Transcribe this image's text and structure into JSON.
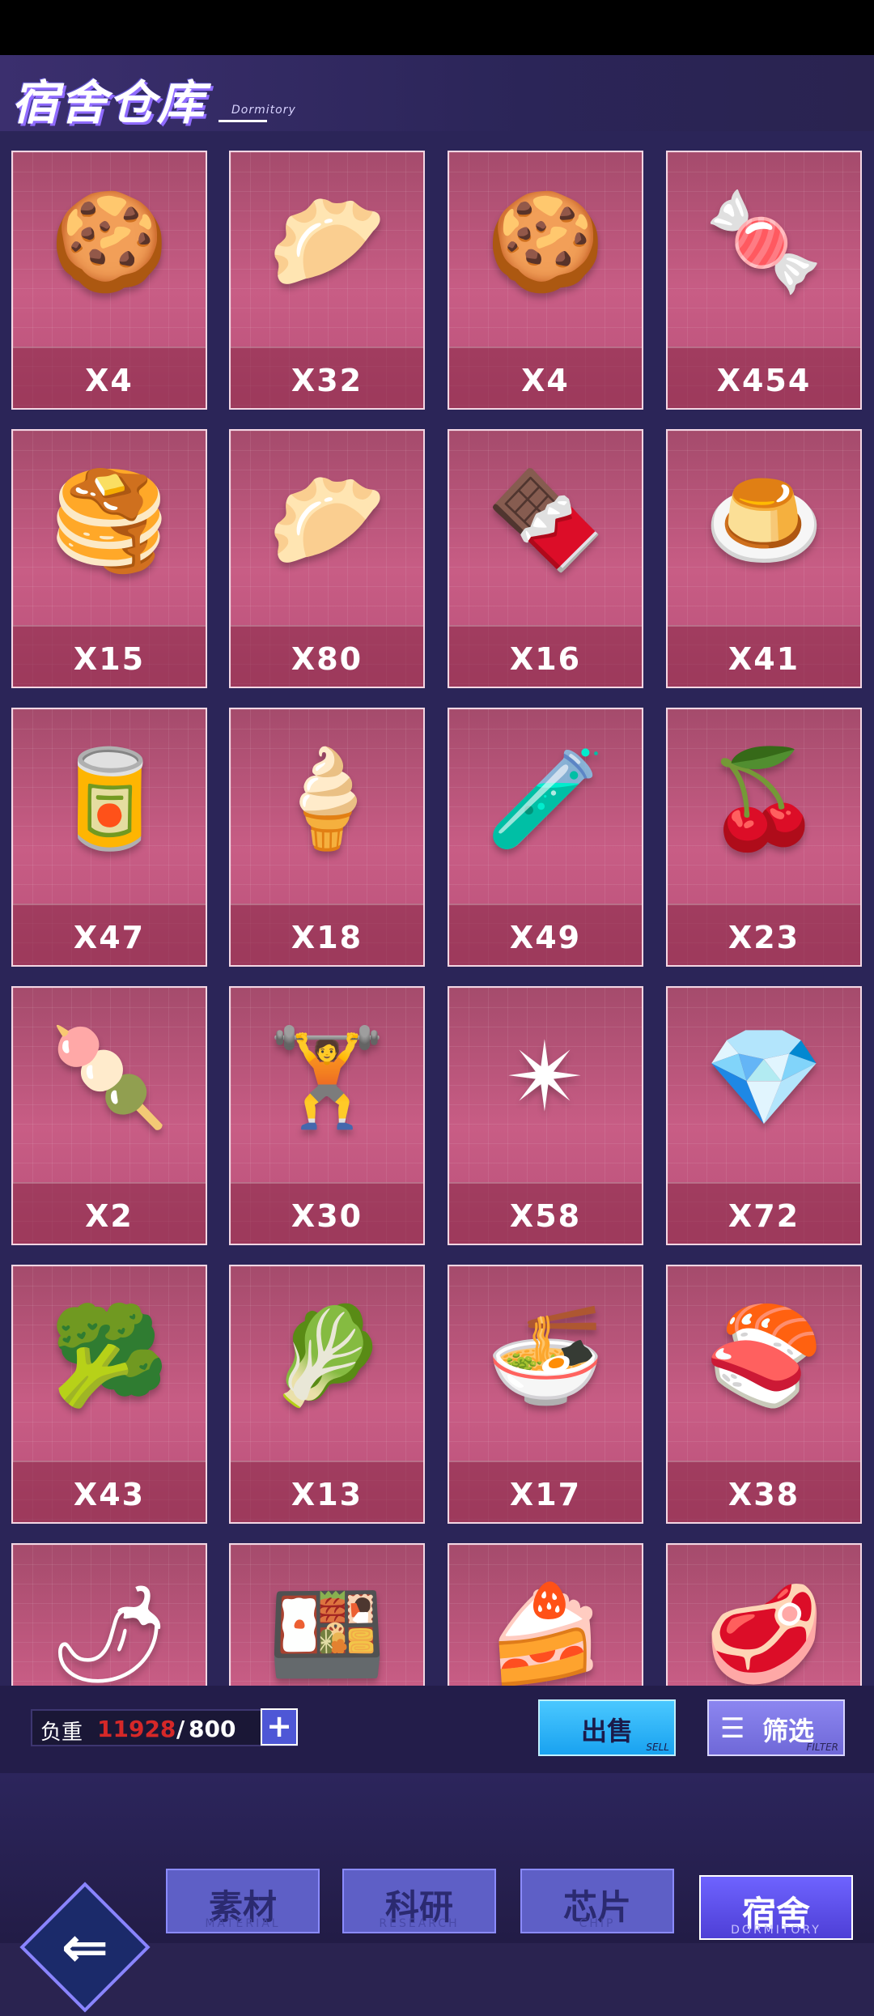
{
  "header": {
    "title": "宿舍仓库",
    "subtitle": "Dormitory"
  },
  "items": [
    {
      "icon": "🍪",
      "qty": "X4"
    },
    {
      "icon": "🥟",
      "qty": "X32"
    },
    {
      "icon": "🍪",
      "qty": "X4"
    },
    {
      "icon": "🍬",
      "qty": "X454"
    },
    {
      "icon": "🥞",
      "qty": "X15"
    },
    {
      "icon": "🥟",
      "qty": "X80"
    },
    {
      "icon": "🍫",
      "qty": "X16"
    },
    {
      "icon": "🍮",
      "qty": "X41"
    },
    {
      "icon": "🥫",
      "qty": "X47"
    },
    {
      "icon": "🍦",
      "qty": "X18"
    },
    {
      "icon": "🧪",
      "qty": "X49"
    },
    {
      "icon": "🍒",
      "qty": "X23"
    },
    {
      "icon": "🍡",
      "qty": "X2"
    },
    {
      "icon": "🏋",
      "qty": "X30"
    },
    {
      "icon": "✴",
      "qty": "X58"
    },
    {
      "icon": "💎",
      "qty": "X72"
    },
    {
      "icon": "🥦",
      "qty": "X43"
    },
    {
      "icon": "🥬",
      "qty": "X13"
    },
    {
      "icon": "🍜",
      "qty": "X17"
    },
    {
      "icon": "🍣",
      "qty": "X38"
    },
    {
      "icon": "🌶",
      "qty": ""
    },
    {
      "icon": "🍱",
      "qty": ""
    },
    {
      "icon": "🍰",
      "qty": ""
    },
    {
      "icon": "🥩",
      "qty": ""
    }
  ],
  "load": {
    "label": "负重",
    "current": "11928",
    "separator": "/",
    "max": "800",
    "plus": "+"
  },
  "actions": {
    "sell": {
      "label": "出售",
      "sub": "SELL"
    },
    "filter": {
      "label": "筛选",
      "sub": "FILTER",
      "icon": "filter-icon"
    }
  },
  "tabs": [
    {
      "label": "素材",
      "sub": "MATERIAL"
    },
    {
      "label": "科研",
      "sub": "RESEARCH"
    },
    {
      "label": "芯片",
      "sub": "CHIP"
    },
    {
      "label": "宿舍",
      "sub": "DORMITORY",
      "active": true
    }
  ],
  "back": {
    "icon": "back-arrow-icon"
  }
}
